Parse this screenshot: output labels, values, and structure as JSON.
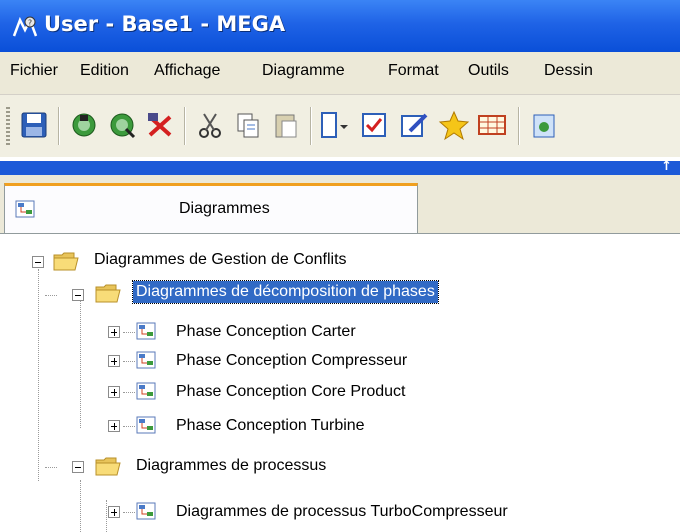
{
  "window": {
    "title": "User - Base1 - MEGA"
  },
  "menu": [
    "Fichier",
    "Edition",
    "Affichage",
    "Diagramme",
    "Format",
    "Outils",
    "Dessin"
  ],
  "toolbar": {
    "buttons": [
      "save-icon",
      "browse-icon",
      "browse-alt-icon",
      "delete-icon",
      "cut-icon",
      "copy-icon",
      "paste-icon",
      "object-menu-icon",
      "check-icon",
      "edit-icon",
      "favorite-icon",
      "table-icon",
      "refresh-icon"
    ]
  },
  "panel": {
    "pin": "↑"
  },
  "tab": {
    "label": "Diagrammes"
  },
  "tree": {
    "root": "Diagrammes de Gestion de Conflits",
    "group1": {
      "label": "Diagrammes de décomposition de phases",
      "items": [
        "Phase Conception Carter",
        "Phase Conception Compresseur",
        "Phase Conception Core Product",
        "Phase Conception Turbine"
      ]
    },
    "group2": {
      "label": "Diagrammes de processus",
      "items": [
        "Diagrammes de processus TurboCompresseur"
      ]
    }
  },
  "colors": {
    "title_bar": "#0a4fd8",
    "selection": "#316ac5",
    "tab_accent": "#f0a020"
  }
}
